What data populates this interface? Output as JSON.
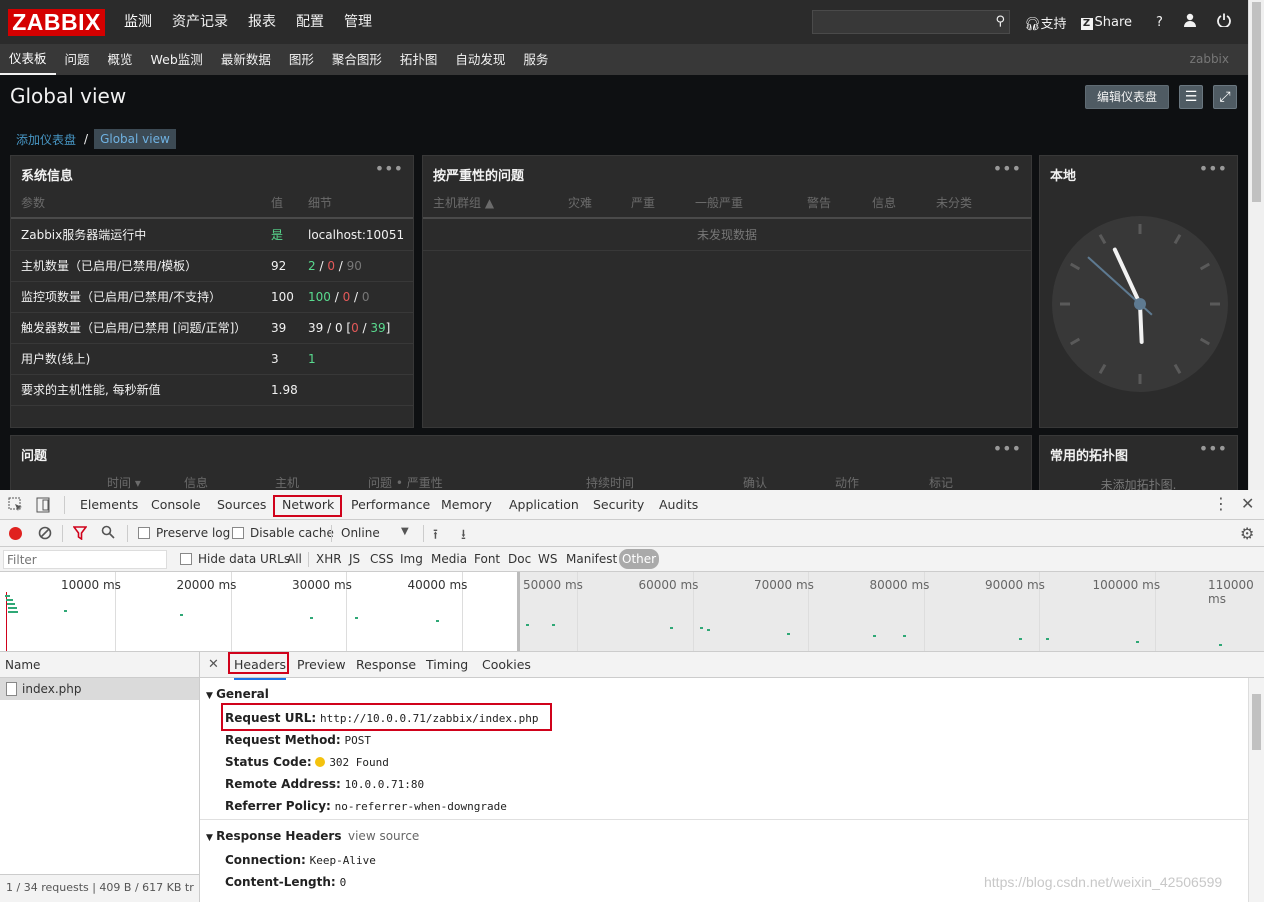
{
  "zabbix": {
    "logo": "ZABBIX",
    "main_menu": [
      "监测",
      "资产记录",
      "报表",
      "配置",
      "管理"
    ],
    "main_menu_selected": "监测",
    "top_links": {
      "support": "支持",
      "share": "Share",
      "help": "?"
    },
    "sub_menu": [
      "仪表板",
      "问题",
      "概览",
      "Web监测",
      "最新数据",
      "图形",
      "聚合图形",
      "拓扑图",
      "自动发现",
      "服务"
    ],
    "sub_menu_selected": "仪表板",
    "user_label": "zabbix",
    "page_title": "Global view",
    "edit_button": "编辑仪表盘",
    "breadcrumb": {
      "parent": "添加仪表盘",
      "separator": "/",
      "current": "Global view"
    },
    "sysinfo": {
      "title": "系统信息",
      "headers": {
        "param": "参数",
        "value": "值",
        "details": "细节"
      },
      "rows": [
        {
          "param": "Zabbix服务器端运行中",
          "value": "是",
          "details": "localhost:10051"
        },
        {
          "param": "主机数量（已启用/已禁用/模板）",
          "value": "92",
          "d1": "2",
          "d2": "0",
          "d3": "90"
        },
        {
          "param": "监控项数量（已启用/已禁用/不支持）",
          "value": "100",
          "d1": "100",
          "d2": "0",
          "d3": "0"
        },
        {
          "param": "触发器数量（已启用/已禁用 [问题/正常]）",
          "value": "39",
          "d_prefix": "39 / 0 [",
          "d2": "0",
          "d3": "39",
          "d_suffix": "]"
        },
        {
          "param": "用户数(线上)",
          "value": "3",
          "d1": "1"
        },
        {
          "param": "要求的主机性能, 每秒新值",
          "value": "1.98"
        }
      ]
    },
    "problems_by_severity": {
      "title": "按严重性的问题",
      "headers": [
        "主机群组 ▲",
        "灾难",
        "严重",
        "一般严重",
        "警告",
        "信息",
        "未分类"
      ],
      "empty": "未发现数据"
    },
    "local_clock": {
      "title": "本地",
      "hour": 5,
      "minute": 55,
      "second": 52
    },
    "problems": {
      "title": "问题",
      "headers": [
        "时间 ▾",
        "信息",
        "主机",
        "问题 • 严重性",
        "持续时间",
        "确认",
        "动作",
        "标记"
      ]
    },
    "favorite_maps": {
      "title": "常用的拓扑图",
      "empty": "未添加拓扑图."
    }
  },
  "devtools": {
    "tabs": [
      "Elements",
      "Console",
      "Sources",
      "Network",
      "Performance",
      "Memory",
      "Application",
      "Security",
      "Audits"
    ],
    "selected_tab": "Network",
    "toolbar": {
      "preserve_log": "Preserve log",
      "disable_cache": "Disable cache",
      "throttle": "Online"
    },
    "filter": {
      "placeholder": "Filter",
      "hide_data_urls": "Hide data URLs",
      "types": [
        "All",
        "XHR",
        "JS",
        "CSS",
        "Img",
        "Media",
        "Font",
        "Doc",
        "WS",
        "Manifest",
        "Other"
      ],
      "selected_type": "Other"
    },
    "timeline_labels": [
      "10000 ms",
      "20000 ms",
      "30000 ms",
      "40000 ms",
      "50000 ms",
      "60000 ms",
      "70000 ms",
      "80000 ms",
      "90000 ms",
      "100000 ms",
      "110000 ms"
    ],
    "requests": {
      "header": "Name",
      "items": [
        "index.php"
      ],
      "status": "1 / 34 requests | 409 B / 617 KB tr"
    },
    "detail_tabs": [
      "Headers",
      "Preview",
      "Response",
      "Timing",
      "Cookies"
    ],
    "selected_detail_tab": "Headers",
    "general": {
      "title": "General",
      "request_url": {
        "label": "Request URL:",
        "value": "http://10.0.0.71/zabbix/index.php"
      },
      "request_method": {
        "label": "Request Method:",
        "value": "POST"
      },
      "status_code": {
        "label": "Status Code:",
        "value": "302 Found"
      },
      "remote_address": {
        "label": "Remote Address:",
        "value": "10.0.0.71:80"
      },
      "referrer_policy": {
        "label": "Referrer Policy:",
        "value": "no-referrer-when-downgrade"
      }
    },
    "response_headers": {
      "title": "Response Headers",
      "view_source": "view source",
      "items": [
        {
          "label": "Connection:",
          "value": "Keep-Alive"
        },
        {
          "label": "Content-Length:",
          "value": "0"
        }
      ]
    }
  },
  "watermark": "https://blog.csdn.net/weixin_42506599"
}
